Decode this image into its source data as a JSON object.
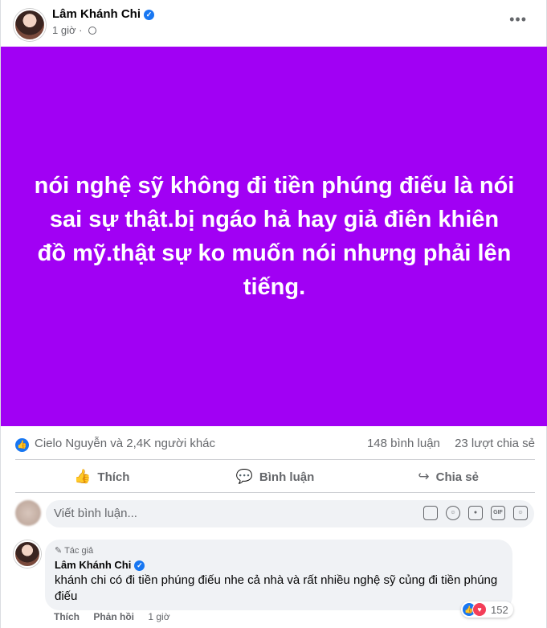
{
  "post": {
    "author": "Lâm Khánh Chi",
    "time": "1 giờ",
    "banner_text": "nói nghệ sỹ không đi tiền phúng điếu là nói sai sự thật.bị ngáo hả hay giả điên khiên đồ mỹ.thật sự ko muốn nói nhưng phải lên tiếng.",
    "banner_color": "#a100f4"
  },
  "stats": {
    "reactions": "Cielo Nguyễn và 2,4K người khác",
    "comments": "148 bình luận",
    "shares": "23 lượt chia sẻ"
  },
  "actions": {
    "like": "Thích",
    "comment": "Bình luận",
    "share": "Chia sẻ"
  },
  "composer": {
    "placeholder": "Viết bình luận..."
  },
  "comment": {
    "badge": "Tác giả",
    "author": "Lâm Khánh Chi",
    "text": "khánh chi có đi tiền phúng điếu nhe cả nhà và rất nhiều nghệ sỹ củng đi tiền phúng điếu",
    "reaction_count": "152",
    "like": "Thích",
    "reply": "Phản hồi",
    "time": "1 giờ"
  },
  "icons": {
    "more": "more-icon",
    "globe": "globe-icon",
    "like": "thumbs-up-icon",
    "comment": "comment-icon",
    "share": "share-icon"
  }
}
